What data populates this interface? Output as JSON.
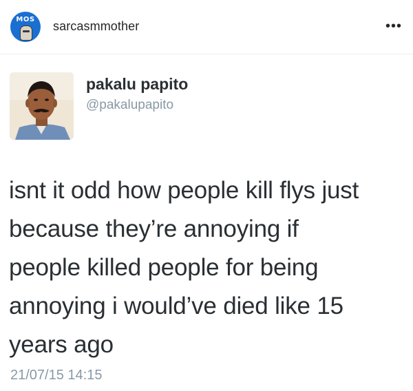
{
  "instagram": {
    "account": "sarcasmmother",
    "avatar_text": "MOS",
    "more_icon": "more-horizontal-icon",
    "more_label": "•••"
  },
  "tweet": {
    "display_name": "pakalu papito",
    "handle": "@pakalupapito",
    "lines": [
      "isnt it odd how people kill flys just",
      "because they’re annoying if",
      "people killed people for being",
      "annoying i would’ve died like 15",
      "years ago"
    ],
    "timestamp": "21/07/15 14:15"
  },
  "colors": {
    "brand_blue": "#1a6fd1",
    "text_dark": "#292f33",
    "text_muted": "#8899a6"
  }
}
